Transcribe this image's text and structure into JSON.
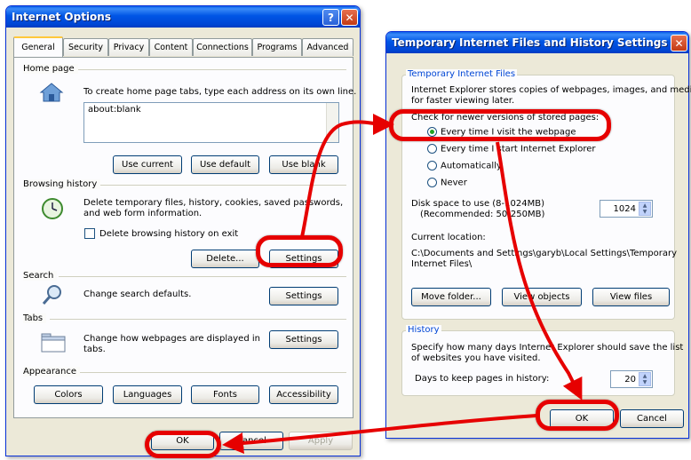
{
  "internet_options": {
    "title": "Internet Options",
    "help_glyph": "?",
    "close_glyph": "✕",
    "tabs": [
      "General",
      "Security",
      "Privacy",
      "Content",
      "Connections",
      "Programs",
      "Advanced"
    ],
    "home_page": {
      "section": "Home page",
      "description": "To create home page tabs, type each address on its own line.",
      "url_value": "about:blank",
      "use_current": "Use current",
      "use_default": "Use default",
      "use_blank": "Use blank"
    },
    "browsing_history": {
      "section": "Browsing history",
      "description_line1": "Delete temporary files, history, cookies, saved passwords,",
      "description_line2": "and web form information.",
      "delete_on_exit": "Delete browsing history on exit",
      "delete_button": "Delete...",
      "settings_button": "Settings"
    },
    "search": {
      "section": "Search",
      "description": "Change search defaults.",
      "settings_button": "Settings"
    },
    "tabs_section": {
      "section": "Tabs",
      "description_line1": "Change how webpages are displayed in",
      "description_line2": "tabs.",
      "settings_button": "Settings"
    },
    "appearance": {
      "section": "Appearance",
      "colors": "Colors",
      "languages": "Languages",
      "fonts": "Fonts",
      "accessibility": "Accessibility"
    },
    "footer": {
      "ok": "OK",
      "cancel": "Cancel",
      "apply": "Apply"
    }
  },
  "temp_files_settings": {
    "title": "Temporary Internet Files and History Settings",
    "close_glyph": "✕",
    "tif_group": {
      "label": "Temporary Internet Files",
      "description_line1": "Internet Explorer stores copies of webpages, images, and media",
      "description_line2": "for faster viewing later.",
      "check_label": "Check for newer versions of stored pages:",
      "options": [
        "Every time I visit the webpage",
        "Every time I start Internet Explorer",
        "Automatically",
        "Never"
      ],
      "selected_option": "Every time I visit the webpage",
      "disk_space_line1": "Disk space to use (8-1024MB)",
      "disk_space_line2": "(Recommended: 50-250MB)",
      "disk_space_value": "1024",
      "current_location_label": "Current location:",
      "current_location_line1": "C:\\Documents and Settings\\garyb\\Local Settings\\Temporary",
      "current_location_line2": "Internet Files\\",
      "move_folder": "Move folder...",
      "view_objects": "View objects",
      "view_files": "View files"
    },
    "history_group": {
      "label": "History",
      "description_line1": "Specify how many days Internet Explorer should save the list",
      "description_line2": "of websites you have visited.",
      "days_label": "Days to keep pages in history:",
      "days_value": "20"
    },
    "footer": {
      "ok": "OK",
      "cancel": "Cancel"
    }
  },
  "spin_arrows": {
    "up": "▲",
    "down": "▼"
  },
  "colors": {
    "highlight_red": "#e60000",
    "xp_title_blue": "#0055e5",
    "dialog_bg": "#ece9d8"
  }
}
